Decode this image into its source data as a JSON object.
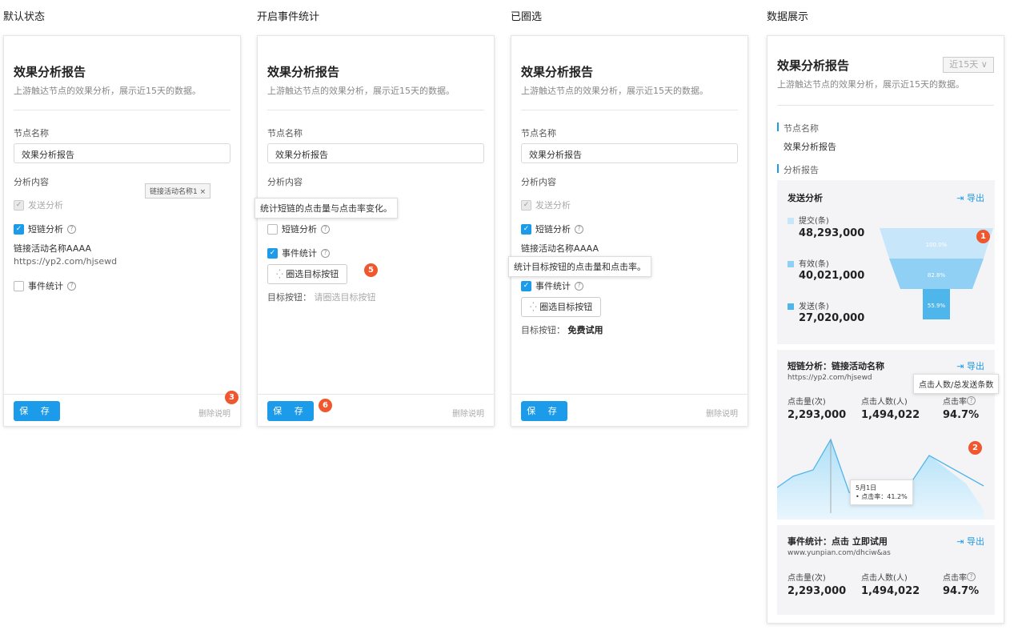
{
  "col_titles": [
    "默认状态",
    "开启事件统计",
    "已圈选",
    "数据展示"
  ],
  "card_title": "效果分析报告",
  "card_sub": "上游触达节点的效果分析，展示近15天的数据。",
  "node_name_label": "节点名称",
  "node_name_value": "效果分析报告",
  "content_label": "分析内容",
  "send_label": "发送分析",
  "shortlink_label": "短链分析",
  "event_label": "事件统计",
  "link_name": "链接活动名称AAAA",
  "link_url": "https://yp2.com/hjsewd",
  "tag_label": "链接活动名称1 ×",
  "save_label": "保 存",
  "delete_label": "删除说明",
  "tip_shortlink": "统计短链的点击量与点击率变化。",
  "tip_event": "统计目标按钮的点击量和点击率。",
  "circle_btn": "圈选目标按钮",
  "target_label": "目标按钮：",
  "target_placeholder": "请圈选目标按钮",
  "target_value": "免费试用",
  "badges": [
    "1",
    "2",
    "3",
    "5",
    "6"
  ],
  "range_select": "近15天",
  "range_caret": "∨",
  "section_node": "节点名称",
  "section_report": "分析报告",
  "send_panel": {
    "title": "发送分析",
    "export": "导出",
    "items": [
      {
        "label": "提交(条)",
        "value": "48,293,000",
        "color": "#c8e6fa"
      },
      {
        "label": "有效(条)",
        "value": "40,021,000",
        "color": "#8fd0f4"
      },
      {
        "label": "发送(条)",
        "value": "27,020,000",
        "color": "#4fb6ec"
      }
    ],
    "funnel": [
      "100.0%",
      "82.8%",
      "55.9%"
    ]
  },
  "short_panel": {
    "title": "短链分析：链接活动名称",
    "url": "https://yp2.com/hjsewd",
    "export": "导出",
    "tip": "点击人数/总发送条数",
    "stats": [
      {
        "label": "点击量(次)",
        "value": "2,293,000"
      },
      {
        "label": "点击人数(人)",
        "value": "1,494,022"
      },
      {
        "label": "点击率",
        "value": "94.7%"
      }
    ],
    "hover_date": "5月1日",
    "hover_value": "• 点击率：41.2%"
  },
  "event_panel": {
    "title": "事件统计：点击 立即试用",
    "url": "www.yunpian.com/dhciw&as",
    "export": "导出",
    "stats": [
      {
        "label": "点击量(次)",
        "value": "2,293,000"
      },
      {
        "label": "点击人数(人)",
        "value": "1,494,022"
      },
      {
        "label": "点击率",
        "value": "94.7%"
      }
    ]
  },
  "icons": {
    "check": "✓",
    "question": "?",
    "export": "⇥",
    "loading": "⁛"
  },
  "colors": {
    "accent": "#1c9bea",
    "badge": "#f0572e"
  }
}
